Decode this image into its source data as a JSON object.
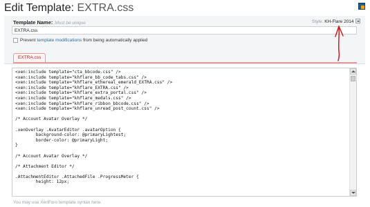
{
  "page": {
    "title_prefix": "Edit Template:",
    "template_name": "EXTRA.css"
  },
  "form": {
    "template_name_label": "Template Name:",
    "template_name_hint": "Must be unique",
    "template_name_value": "EXTRA.css",
    "style_label": "Style:",
    "style_value": "KH-Flare 2014",
    "prevent_text_before": "Prevent",
    "prevent_link": "template modifications",
    "prevent_text_after": "from being automatically applied",
    "prevent_checked": false
  },
  "tabs": [
    {
      "label": "EXTRA.css",
      "active": true
    }
  ],
  "editor": {
    "lines": [
      "<xen:include template=\"cta_bbcode.css\" />",
      "<xen:include template=\"khflare_bb_code_tabs.css\" />",
      "<xen:include template=\"khflare_ethereal_emerald_EXTRA.css\" />",
      "<xen:include template=\"khflare_EXTRA.css\" />",
      "<xen:include template=\"khflare_extra_portal.css\" />",
      "<xen:include template=\"khflare_medals.css\" />",
      "<xen:include template=\"khflare_ribbon_bbcode.css\" />",
      "<xen:include template=\"khflare_unread_post_count.css\" />",
      "",
      "/* Account Avatar Overlay */",
      "",
      ".xenOverlay .AvatarEditor .avatarOption {",
      "        background-color: @primaryLightest;",
      "        border-color: @primaryLight;",
      "}",
      "",
      "/* Account Avatar Overlay */",
      "",
      "/* Attachment Editor */",
      "",
      ".AttachmentEditor .AttachedFile .ProgressMeter {",
      "        height: 12px;"
    ]
  },
  "footer": {
    "hint": "You may use XenForo template syntax here."
  },
  "colors": {
    "accent": "#2c6e9b",
    "tab_border": "#e79898",
    "annotation_red": "#c42020"
  }
}
